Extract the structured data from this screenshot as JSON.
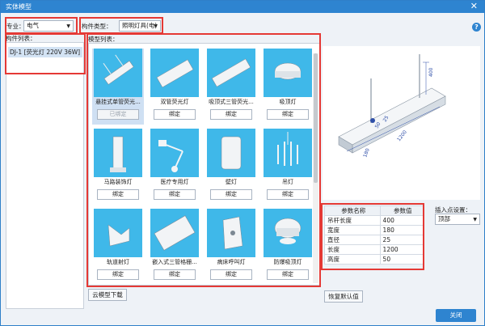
{
  "window": {
    "title": "实体模型",
    "close_glyph": "✕"
  },
  "specialty": {
    "label": "专业：",
    "value": "电气"
  },
  "component_type": {
    "label": "构件类型：",
    "value": "照明灯具(电)"
  },
  "component_list": {
    "label": "构件列表：",
    "items": [
      "DJ-1 [荧光灯 220V 36W]"
    ]
  },
  "model_list": {
    "label": "模型列表：",
    "cards": [
      {
        "name": "悬挂式单管荧光...",
        "button": "已绑定",
        "selected": true,
        "icon": "suspended-single-tube-fluorescent-icon"
      },
      {
        "name": "双管荧光灯",
        "button": "绑定",
        "icon": "double-tube-fluorescent-icon"
      },
      {
        "name": "吸顶式三管荧光...",
        "button": "绑定",
        "icon": "ceiling-triple-tube-fluorescent-icon"
      },
      {
        "name": "吸顶灯",
        "button": "绑定",
        "icon": "ceiling-lamp-icon"
      },
      {
        "name": "马路装饰灯",
        "button": "绑定",
        "icon": "road-decorative-lamp-icon"
      },
      {
        "name": "医疗专用灯",
        "button": "绑定",
        "icon": "medical-lamp-icon"
      },
      {
        "name": "壁灯",
        "button": "绑定",
        "icon": "wall-lamp-icon"
      },
      {
        "name": "吊灯",
        "button": "绑定",
        "icon": "chandelier-icon"
      },
      {
        "name": "轨道射灯",
        "button": "绑定",
        "icon": "track-spotlight-icon"
      },
      {
        "name": "嵌入式三管格栅...",
        "button": "绑定",
        "icon": "recessed-grille-lamp-icon"
      },
      {
        "name": "病床呼叫灯",
        "button": "绑定",
        "icon": "bed-call-lamp-icon"
      },
      {
        "name": "防爆吸顶灯",
        "button": "绑定",
        "icon": "explosion-proof-ceiling-lamp-icon"
      }
    ]
  },
  "download_button": "云模型下载",
  "preview": {
    "dims": {
      "height": "400",
      "width": "180",
      "length": "1200",
      "diam": "25",
      "thick": "50"
    }
  },
  "params": {
    "headers": [
      "参数名称",
      "参数值"
    ],
    "rows": [
      {
        "name": "吊杆长度",
        "value": "400"
      },
      {
        "name": "宽度",
        "value": "180"
      },
      {
        "name": "直径",
        "value": "25"
      },
      {
        "name": "长度",
        "value": "1200"
      },
      {
        "name": "高度",
        "value": "50"
      }
    ]
  },
  "insert_point": {
    "label": "插入点设置：",
    "value": "顶部"
  },
  "restore_button": "恢复默认值",
  "close_button": "关闭",
  "help_glyph": "?",
  "colors": {
    "accent": "#2e84d0",
    "thumb_bg": "#3fb8e9",
    "highlight": "#e53935"
  }
}
